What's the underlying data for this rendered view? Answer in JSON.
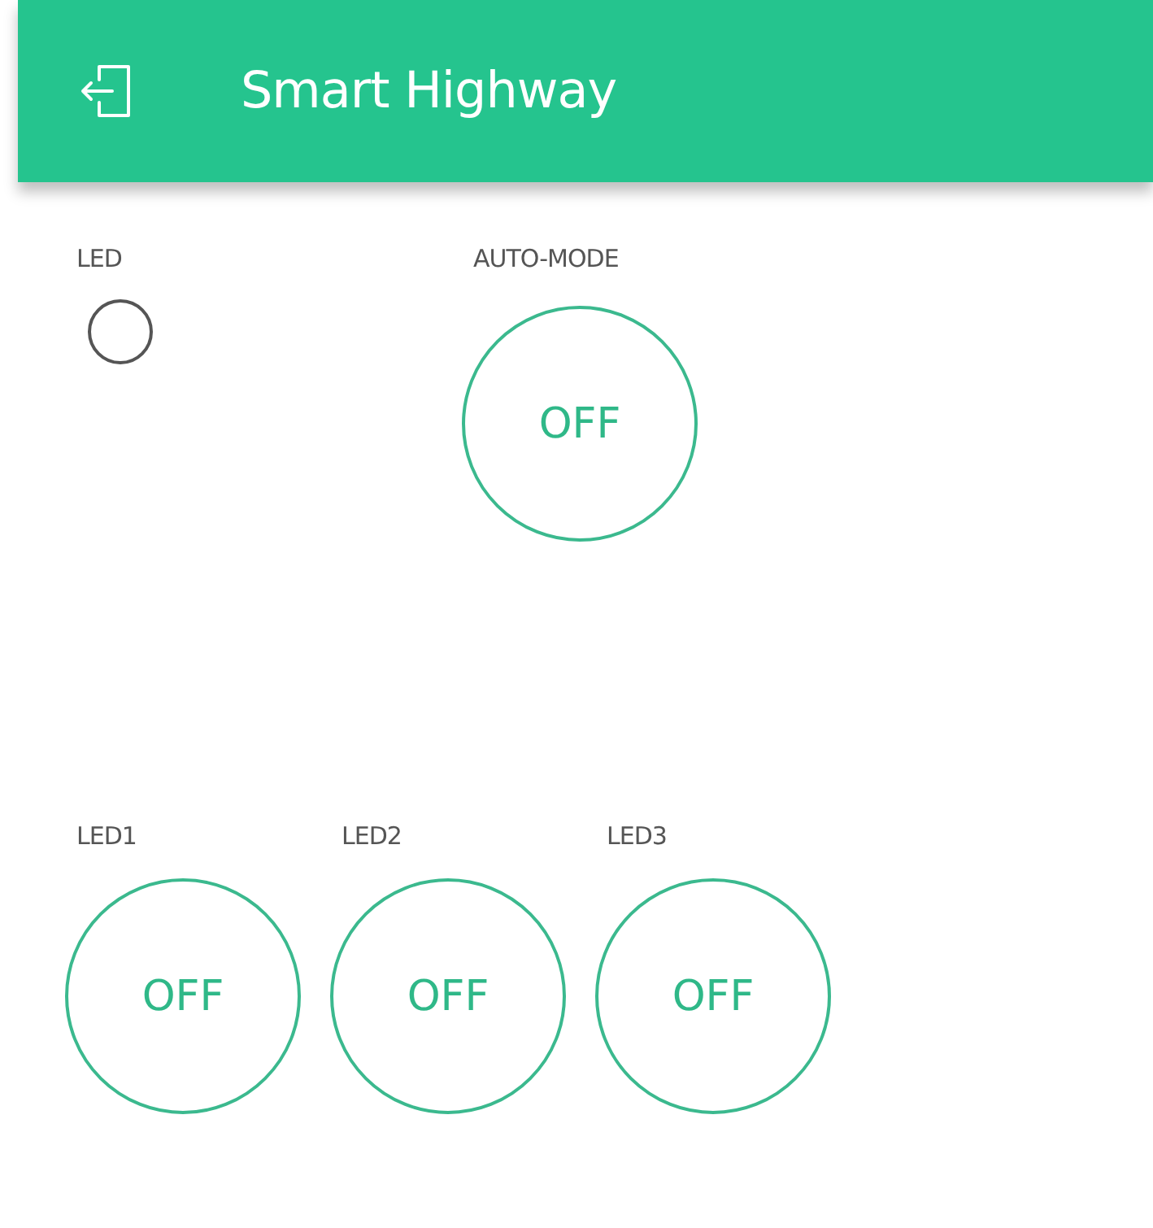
{
  "header": {
    "title": "Smart Highway"
  },
  "top_widgets": [
    {
      "kind": "led",
      "label": "LED",
      "on": false
    },
    {
      "kind": "button",
      "label": "AUTO-MODE",
      "text": "OFF",
      "on": false
    }
  ],
  "bottom_widgets": [
    {
      "kind": "button",
      "label": "LED1",
      "text": "OFF",
      "on": false
    },
    {
      "kind": "button",
      "label": "LED2",
      "text": "OFF",
      "on": false
    },
    {
      "kind": "button",
      "label": "LED3",
      "text": "OFF",
      "on": false
    }
  ]
}
